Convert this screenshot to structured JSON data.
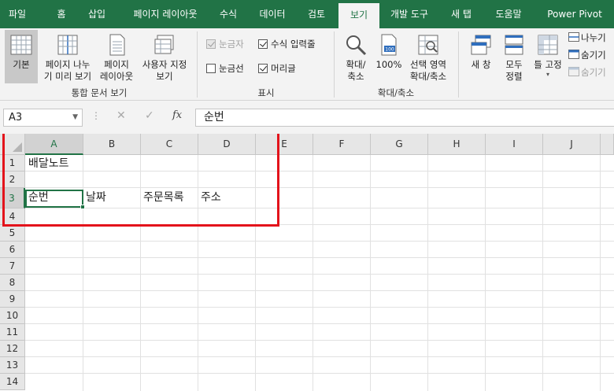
{
  "tabs": [
    {
      "label": "파일",
      "active": false
    },
    {
      "label": "홈",
      "active": false
    },
    {
      "label": "삽입",
      "active": false
    },
    {
      "label": "페이지 레이아웃",
      "active": false
    },
    {
      "label": "수식",
      "active": false
    },
    {
      "label": "데이터",
      "active": false
    },
    {
      "label": "검토",
      "active": false
    },
    {
      "label": "보기",
      "active": true
    },
    {
      "label": "개발 도구",
      "active": false
    },
    {
      "label": "새 탭",
      "active": false
    },
    {
      "label": "도움말",
      "active": false
    },
    {
      "label": "Power Pivot",
      "active": false
    }
  ],
  "ribbon": {
    "workbook_views": {
      "group_label": "통합 문서 보기",
      "normal": {
        "label": "기본",
        "selected": true
      },
      "page_break_preview": {
        "line1": "페이지 나누",
        "line2": "기 미리 보기"
      },
      "page_layout": {
        "line1": "페이지",
        "line2": "레이아웃"
      },
      "custom_views": {
        "line1": "사용자 지정",
        "line2": "보기"
      }
    },
    "show": {
      "group_label": "표시",
      "ruler": {
        "label": "눈금자",
        "checked": true,
        "disabled": true
      },
      "formula_bar": {
        "label": "수식 입력줄",
        "checked": true
      },
      "gridlines": {
        "label": "눈금선",
        "checked": false
      },
      "headings": {
        "label": "머리글",
        "checked": true
      }
    },
    "zoom": {
      "group_label": "확대/축소",
      "zoom": {
        "line1": "확대/",
        "line2": "축소"
      },
      "hundred": {
        "label": "100%"
      },
      "zoom_to_selection": {
        "line1": "선택 영역",
        "line2": "확대/축소"
      }
    },
    "window": {
      "new_window": {
        "label": "새 창"
      },
      "arrange_all": {
        "line1": "모두",
        "line2": "정렬"
      },
      "freeze_panes": {
        "label": "틀 고정"
      },
      "split": {
        "label": "나누기"
      },
      "hide": {
        "label": "숨기기"
      },
      "unhide": {
        "label": "숨기기",
        "disabled": true
      }
    }
  },
  "formula_bar": {
    "name_box": "A3",
    "cancel_symbol": "✕",
    "enter_symbol": "✓",
    "fx_symbol": "fx",
    "value": "순번"
  },
  "sheet": {
    "columns": [
      "A",
      "B",
      "C",
      "D",
      "E",
      "F",
      "G",
      "H",
      "I",
      "J"
    ],
    "selected_column": "A",
    "rows": [
      "1",
      "2",
      "3",
      "4",
      "5",
      "6",
      "7",
      "8",
      "9",
      "10",
      "11",
      "12",
      "13",
      "14"
    ],
    "selected_row": "3",
    "cells": {
      "A1": "배달노트",
      "A3": "순번",
      "B3": "날짜",
      "C3": "주문목록",
      "D3": "주소"
    },
    "active_cell": "A3",
    "highlight_color": "#e3131b"
  },
  "colors": {
    "accent": "#217346",
    "ribbon_bg": "#f3f3f3"
  }
}
